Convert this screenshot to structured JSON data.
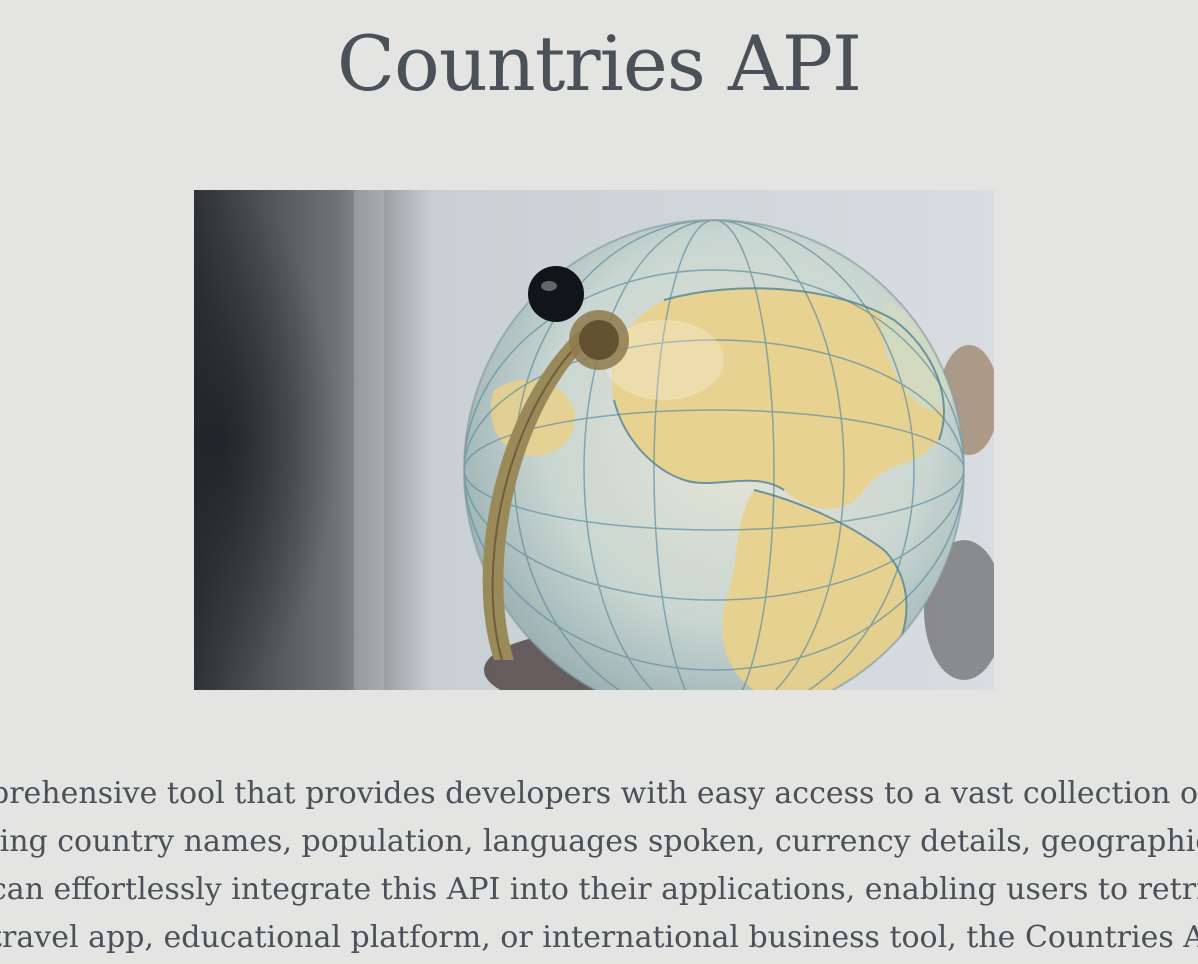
{
  "page": {
    "title": "Countries API",
    "hero_image": {
      "subject": "globe-photo",
      "colors": {
        "background": "#9aa4ab",
        "ocean": "#b9cfd2",
        "land": "#e9d08a",
        "meridian": "#9a8a5a",
        "knob": "#111418"
      }
    },
    "description_lines": [
      "prehensive tool that provides developers with easy access to a vast collection of inform",
      "ling country names, population, languages spoken, currency details, geographical loc",
      "can effortlessly integrate this API into their applications, enabling users to retrieve ac",
      "travel app, educational platform, or international business tool, the Countries API em"
    ]
  }
}
